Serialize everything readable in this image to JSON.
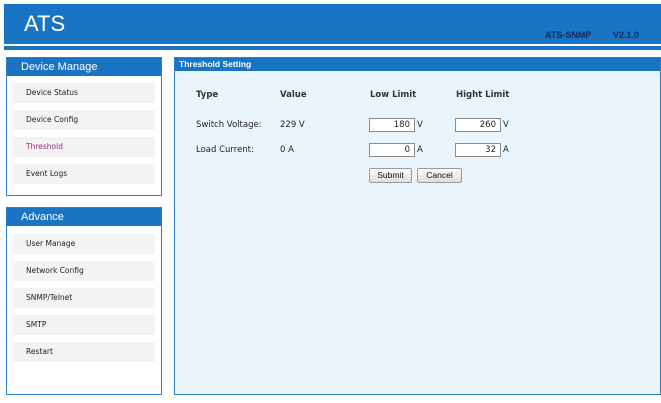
{
  "header": {
    "brand": "ATS",
    "product": "ATS-SNMP",
    "version": "V2.1.0"
  },
  "sidebar": {
    "manage": {
      "title": "Device Manage",
      "items": [
        {
          "label": "Device Status"
        },
        {
          "label": "Device Config"
        },
        {
          "label": "Threshold",
          "active": true
        },
        {
          "label": "Event Logs"
        }
      ]
    },
    "advance": {
      "title": "Advance",
      "items": [
        {
          "label": "User Manage"
        },
        {
          "label": "Network Config"
        },
        {
          "label": "SNMP/Telnet"
        },
        {
          "label": "SMTP"
        },
        {
          "label": "Restart"
        }
      ]
    }
  },
  "main": {
    "title": "Threshold Setting",
    "columns": {
      "type": "Type",
      "value": "Value",
      "low": "Low Limit",
      "high": "Hight Limit"
    },
    "rows": [
      {
        "type": "Switch Voltage:",
        "value": "229 V",
        "low": "180",
        "low_unit": "V",
        "high": "260",
        "high_unit": "V"
      },
      {
        "type": "Load Current:",
        "value": "0 A",
        "low": "0",
        "low_unit": "A",
        "high": "32",
        "high_unit": "A"
      }
    ],
    "buttons": {
      "submit": "Submit",
      "cancel": "Cancel"
    }
  },
  "colors": {
    "brand_blue": "#1a74c4",
    "panel_bg": "#eaf4fd",
    "active_item": "#9b2a7e"
  }
}
